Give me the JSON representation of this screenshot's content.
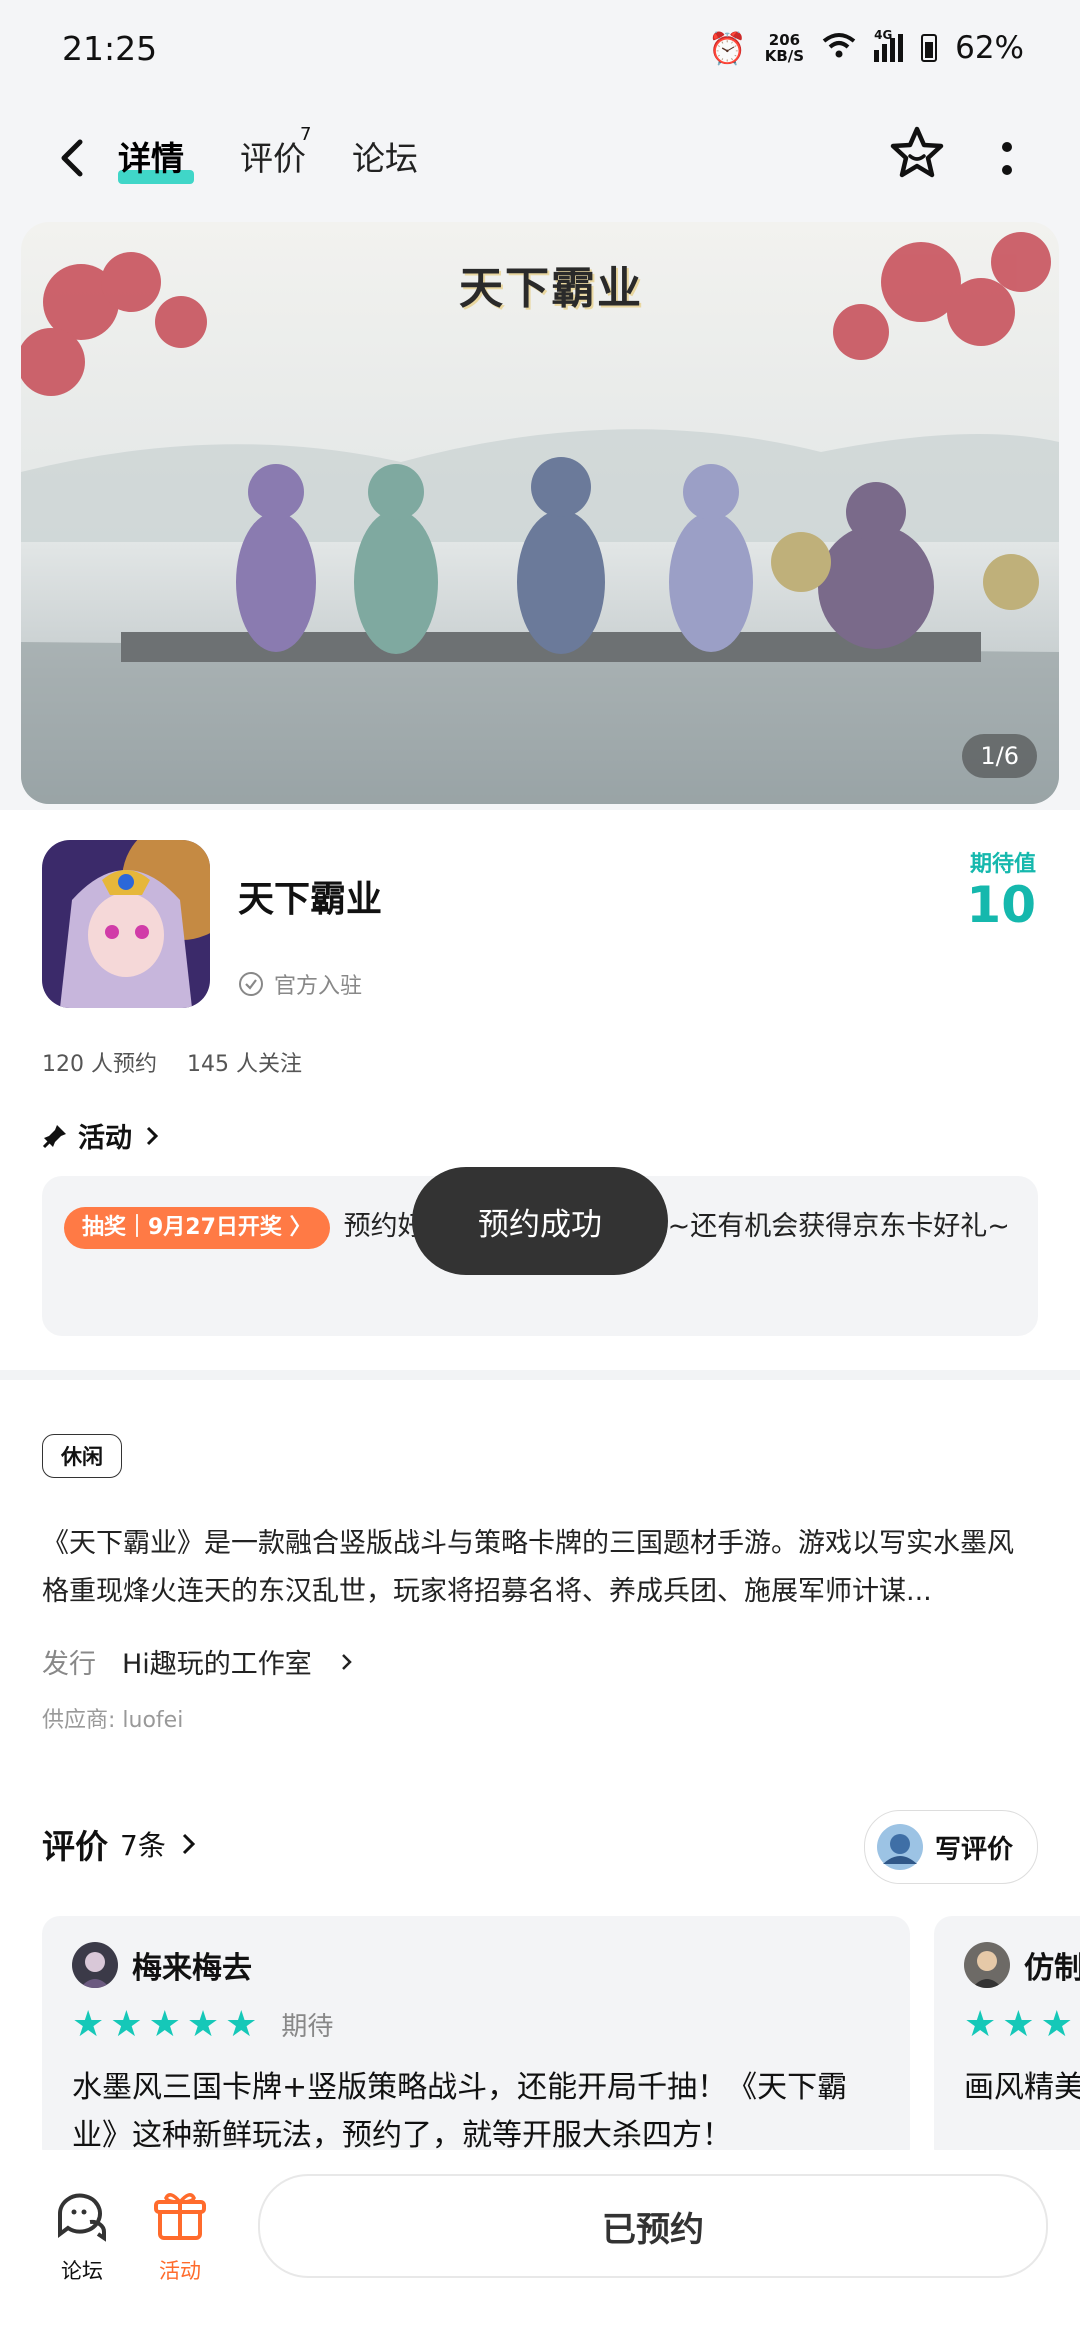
{
  "status": {
    "time": "21:25",
    "net_speed_value": "206",
    "net_speed_unit": "KB/S",
    "network": "4G",
    "battery": "62%"
  },
  "tabs": [
    {
      "label": "详情"
    },
    {
      "label": "评价",
      "badge": "7"
    },
    {
      "label": "论坛"
    }
  ],
  "banner": {
    "logo": "天下霸业",
    "counter": "1/6"
  },
  "app": {
    "name": "天下霸业",
    "official": "官方入驻",
    "expect_label": "期待值",
    "expect_value": "10",
    "reservations": "120 人预约",
    "followers": "145 人关注"
  },
  "activity": {
    "title": "活动",
    "badge": "抽奖｜9月27日开奖 〉",
    "text": "预约好游戏，一起来看看吧~还有机会获得京东卡好礼~"
  },
  "toast": "预约成功",
  "details": {
    "tag": "休闲",
    "description": "《天下霸业》是一款融合竖版战斗与策略卡牌的三国题材手游。游戏以写实水墨风格重现烽火连天的东汉乱世，玩家将招募名将、养成兵团、施展军师计谋...",
    "publisher_label": "发行",
    "publisher": "Hi趣玩的工作室",
    "supplier": "供应商:  luofei"
  },
  "reviews": {
    "title": "评价",
    "count": "7条",
    "write_label": "写评价",
    "items": [
      {
        "user": "梅来梅去",
        "rating_label": "期待",
        "text": "水墨风三国卡牌+竖版策略战斗，还能开局千抽！《天下霸业》这种新鲜玩法，预约了，就等开服大杀四方！"
      },
      {
        "user": "仿制",
        "text": "画风精美"
      }
    ]
  },
  "bottom": {
    "forum": "论坛",
    "activity": "活动",
    "reserved": "已预约"
  },
  "colors": {
    "accent": "#15b8ad",
    "orange": "#ff7a45"
  }
}
